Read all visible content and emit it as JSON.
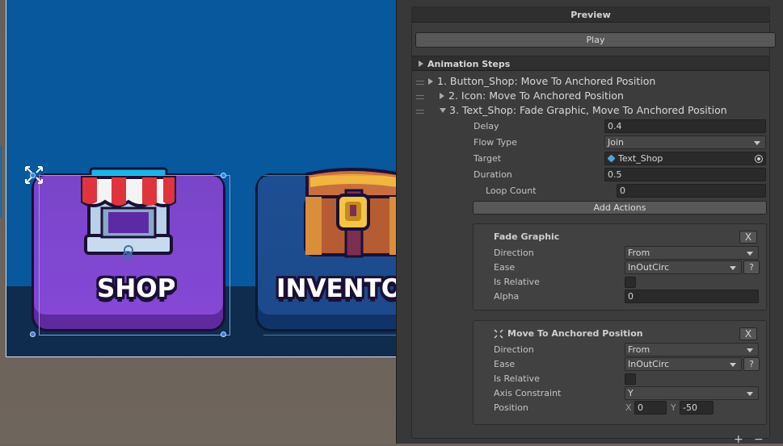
{
  "scene": {
    "shop_label": "SHOP",
    "inventory_label": "INVENTO"
  },
  "inspector": {
    "preview_header": "Preview",
    "play_button": "Play",
    "animation_steps_header": "Animation Steps",
    "steps": [
      {
        "label": "1. Button_Shop: Move To Anchored Position",
        "expanded": false
      },
      {
        "label": "2. Icon: Move To Anchored Position",
        "expanded": false
      },
      {
        "label": "3. Text_Shop: Fade Graphic, Move To Anchored Position",
        "expanded": true
      }
    ],
    "fields": {
      "delay_label": "Delay",
      "delay_value": "0.4",
      "flow_type_label": "Flow Type",
      "flow_type_value": "Join",
      "target_label": "Target",
      "target_value": "Text_Shop",
      "duration_label": "Duration",
      "duration_value": "0.5",
      "loop_count_label": "Loop Count",
      "loop_count_value": "0"
    },
    "add_actions_button": "Add Actions",
    "fade_graphic": {
      "title": "Fade Graphic",
      "close": "X",
      "direction_label": "Direction",
      "direction_value": "From",
      "ease_label": "Ease",
      "ease_value": "InOutCirc",
      "help": "?",
      "is_relative_label": "Is Relative",
      "alpha_label": "Alpha",
      "alpha_value": "0"
    },
    "move_anchored": {
      "title": "Move To Anchored Position",
      "close": "X",
      "direction_label": "Direction",
      "direction_value": "From",
      "ease_label": "Ease",
      "ease_value": "InOutCirc",
      "help": "?",
      "is_relative_label": "Is Relative",
      "axis_constraint_label": "Axis Constraint",
      "axis_constraint_value": "Y",
      "position_label": "Position",
      "x_label": "X",
      "x_value": "0",
      "y_label": "Y",
      "y_value": "-50"
    },
    "footer": {
      "plus": "+",
      "minus": "−"
    }
  },
  "colors": {
    "game_bg": "#07589d",
    "shop_purple": "#7a45c9",
    "inventory_blue": "#1e4f92",
    "editor_bg": "#383838",
    "selection_handle": "#3a7be0"
  }
}
